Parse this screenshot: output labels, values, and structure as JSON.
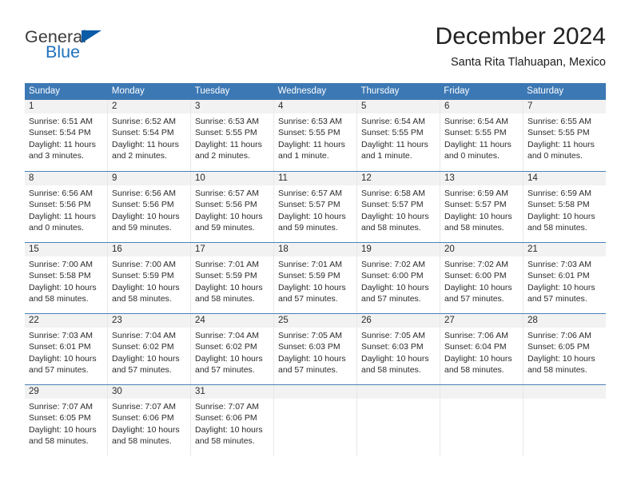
{
  "brand": {
    "name_top": "General",
    "name_bottom": "Blue",
    "accent_color": "#0a5ca8",
    "blue_text_color": "#1f72bd"
  },
  "header": {
    "month_title": "December 2024",
    "location": "Santa Rita Tlahuapan, Mexico"
  },
  "calendar": {
    "header_bg": "#3c78b4",
    "daynum_bg": "#f2f2f2",
    "weekdays": [
      "Sunday",
      "Monday",
      "Tuesday",
      "Wednesday",
      "Thursday",
      "Friday",
      "Saturday"
    ],
    "weeks": [
      [
        {
          "day": "1",
          "sunrise": "Sunrise: 6:51 AM",
          "sunset": "Sunset: 5:54 PM",
          "daylight": "Daylight: 11 hours and 3 minutes."
        },
        {
          "day": "2",
          "sunrise": "Sunrise: 6:52 AM",
          "sunset": "Sunset: 5:54 PM",
          "daylight": "Daylight: 11 hours and 2 minutes."
        },
        {
          "day": "3",
          "sunrise": "Sunrise: 6:53 AM",
          "sunset": "Sunset: 5:55 PM",
          "daylight": "Daylight: 11 hours and 2 minutes."
        },
        {
          "day": "4",
          "sunrise": "Sunrise: 6:53 AM",
          "sunset": "Sunset: 5:55 PM",
          "daylight": "Daylight: 11 hours and 1 minute."
        },
        {
          "day": "5",
          "sunrise": "Sunrise: 6:54 AM",
          "sunset": "Sunset: 5:55 PM",
          "daylight": "Daylight: 11 hours and 1 minute."
        },
        {
          "day": "6",
          "sunrise": "Sunrise: 6:54 AM",
          "sunset": "Sunset: 5:55 PM",
          "daylight": "Daylight: 11 hours and 0 minutes."
        },
        {
          "day": "7",
          "sunrise": "Sunrise: 6:55 AM",
          "sunset": "Sunset: 5:55 PM",
          "daylight": "Daylight: 11 hours and 0 minutes."
        }
      ],
      [
        {
          "day": "8",
          "sunrise": "Sunrise: 6:56 AM",
          "sunset": "Sunset: 5:56 PM",
          "daylight": "Daylight: 11 hours and 0 minutes."
        },
        {
          "day": "9",
          "sunrise": "Sunrise: 6:56 AM",
          "sunset": "Sunset: 5:56 PM",
          "daylight": "Daylight: 10 hours and 59 minutes."
        },
        {
          "day": "10",
          "sunrise": "Sunrise: 6:57 AM",
          "sunset": "Sunset: 5:56 PM",
          "daylight": "Daylight: 10 hours and 59 minutes."
        },
        {
          "day": "11",
          "sunrise": "Sunrise: 6:57 AM",
          "sunset": "Sunset: 5:57 PM",
          "daylight": "Daylight: 10 hours and 59 minutes."
        },
        {
          "day": "12",
          "sunrise": "Sunrise: 6:58 AM",
          "sunset": "Sunset: 5:57 PM",
          "daylight": "Daylight: 10 hours and 58 minutes."
        },
        {
          "day": "13",
          "sunrise": "Sunrise: 6:59 AM",
          "sunset": "Sunset: 5:57 PM",
          "daylight": "Daylight: 10 hours and 58 minutes."
        },
        {
          "day": "14",
          "sunrise": "Sunrise: 6:59 AM",
          "sunset": "Sunset: 5:58 PM",
          "daylight": "Daylight: 10 hours and 58 minutes."
        }
      ],
      [
        {
          "day": "15",
          "sunrise": "Sunrise: 7:00 AM",
          "sunset": "Sunset: 5:58 PM",
          "daylight": "Daylight: 10 hours and 58 minutes."
        },
        {
          "day": "16",
          "sunrise": "Sunrise: 7:00 AM",
          "sunset": "Sunset: 5:59 PM",
          "daylight": "Daylight: 10 hours and 58 minutes."
        },
        {
          "day": "17",
          "sunrise": "Sunrise: 7:01 AM",
          "sunset": "Sunset: 5:59 PM",
          "daylight": "Daylight: 10 hours and 58 minutes."
        },
        {
          "day": "18",
          "sunrise": "Sunrise: 7:01 AM",
          "sunset": "Sunset: 5:59 PM",
          "daylight": "Daylight: 10 hours and 57 minutes."
        },
        {
          "day": "19",
          "sunrise": "Sunrise: 7:02 AM",
          "sunset": "Sunset: 6:00 PM",
          "daylight": "Daylight: 10 hours and 57 minutes."
        },
        {
          "day": "20",
          "sunrise": "Sunrise: 7:02 AM",
          "sunset": "Sunset: 6:00 PM",
          "daylight": "Daylight: 10 hours and 57 minutes."
        },
        {
          "day": "21",
          "sunrise": "Sunrise: 7:03 AM",
          "sunset": "Sunset: 6:01 PM",
          "daylight": "Daylight: 10 hours and 57 minutes."
        }
      ],
      [
        {
          "day": "22",
          "sunrise": "Sunrise: 7:03 AM",
          "sunset": "Sunset: 6:01 PM",
          "daylight": "Daylight: 10 hours and 57 minutes."
        },
        {
          "day": "23",
          "sunrise": "Sunrise: 7:04 AM",
          "sunset": "Sunset: 6:02 PM",
          "daylight": "Daylight: 10 hours and 57 minutes."
        },
        {
          "day": "24",
          "sunrise": "Sunrise: 7:04 AM",
          "sunset": "Sunset: 6:02 PM",
          "daylight": "Daylight: 10 hours and 57 minutes."
        },
        {
          "day": "25",
          "sunrise": "Sunrise: 7:05 AM",
          "sunset": "Sunset: 6:03 PM",
          "daylight": "Daylight: 10 hours and 57 minutes."
        },
        {
          "day": "26",
          "sunrise": "Sunrise: 7:05 AM",
          "sunset": "Sunset: 6:03 PM",
          "daylight": "Daylight: 10 hours and 58 minutes."
        },
        {
          "day": "27",
          "sunrise": "Sunrise: 7:06 AM",
          "sunset": "Sunset: 6:04 PM",
          "daylight": "Daylight: 10 hours and 58 minutes."
        },
        {
          "day": "28",
          "sunrise": "Sunrise: 7:06 AM",
          "sunset": "Sunset: 6:05 PM",
          "daylight": "Daylight: 10 hours and 58 minutes."
        }
      ],
      [
        {
          "day": "29",
          "sunrise": "Sunrise: 7:07 AM",
          "sunset": "Sunset: 6:05 PM",
          "daylight": "Daylight: 10 hours and 58 minutes."
        },
        {
          "day": "30",
          "sunrise": "Sunrise: 7:07 AM",
          "sunset": "Sunset: 6:06 PM",
          "daylight": "Daylight: 10 hours and 58 minutes."
        },
        {
          "day": "31",
          "sunrise": "Sunrise: 7:07 AM",
          "sunset": "Sunset: 6:06 PM",
          "daylight": "Daylight: 10 hours and 58 minutes."
        },
        {
          "day": "",
          "sunrise": "",
          "sunset": "",
          "daylight": ""
        },
        {
          "day": "",
          "sunrise": "",
          "sunset": "",
          "daylight": ""
        },
        {
          "day": "",
          "sunrise": "",
          "sunset": "",
          "daylight": ""
        },
        {
          "day": "",
          "sunrise": "",
          "sunset": "",
          "daylight": ""
        }
      ]
    ]
  }
}
